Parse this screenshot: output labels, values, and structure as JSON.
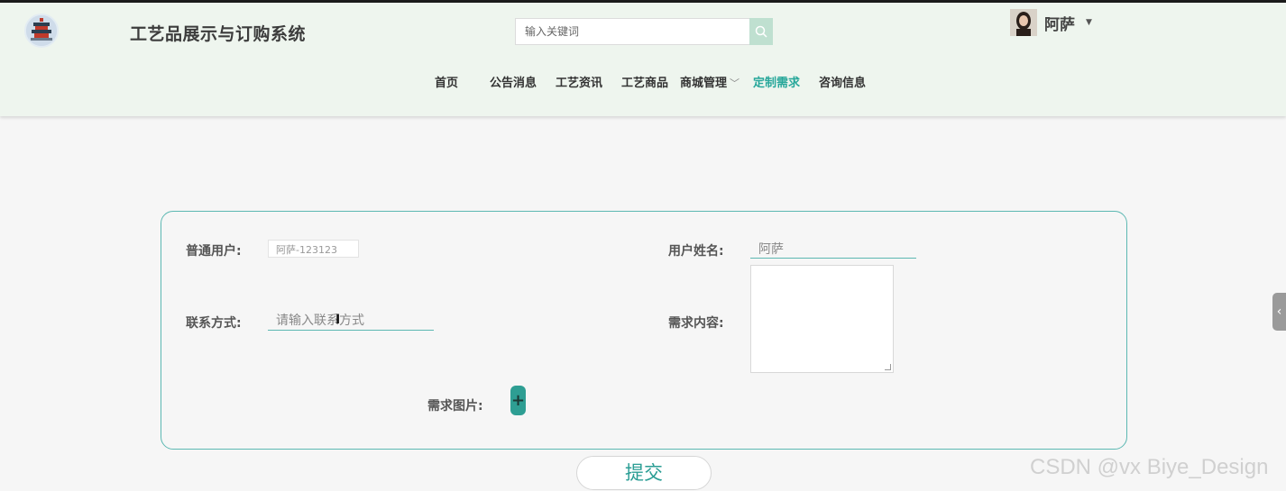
{
  "header": {
    "site_title": "工艺品展示与订购系统",
    "logo_icon": "temple-logo-icon",
    "search_placeholder": "输入关键词",
    "search_icon": "search-icon",
    "user": {
      "name": "阿萨",
      "avatar_icon": "user-avatar"
    },
    "nav": [
      {
        "label": "首页",
        "active": false
      },
      {
        "label": "公告消息",
        "active": false
      },
      {
        "label": "工艺资讯",
        "active": false
      },
      {
        "label": "工艺商品",
        "active": false
      },
      {
        "label": "商城管理",
        "active": false,
        "has_dropdown": true
      },
      {
        "label": "定制需求",
        "active": true
      },
      {
        "label": "咨询信息",
        "active": false
      }
    ]
  },
  "form": {
    "user_label": "普通用户:",
    "user_value": "阿萨-123123",
    "name_label": "用户姓名:",
    "name_value": "阿萨",
    "contact_label": "联系方式:",
    "contact_placeholder": "请输入联系方式",
    "content_label": "需求内容:",
    "image_label": "需求图片:",
    "add_icon": "+"
  },
  "submit_label": "提交",
  "side_tab_icon": "‹",
  "watermark": "CSDN @vx Biye_Design",
  "colors": {
    "accent": "#27a79a",
    "header_bg": "#eef5ee",
    "border": "#5cb8b2"
  }
}
